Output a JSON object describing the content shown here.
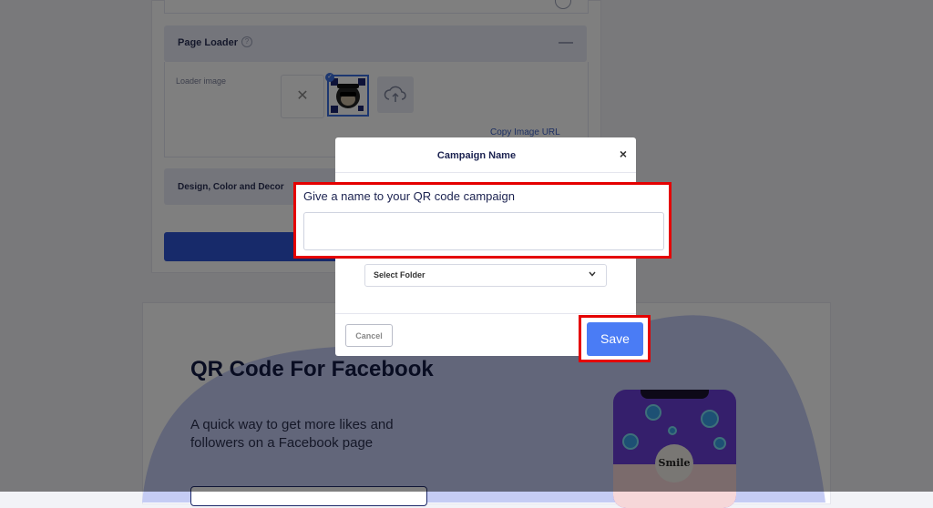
{
  "background": {
    "section_page_loader": {
      "title": "Page Loader",
      "help_icon": "question-circle-icon",
      "collapse_icon": "minus-icon",
      "loader_image_label": "Loader image",
      "copy_image_url": "Copy Image URL"
    },
    "section_design": {
      "title": "Design, Color and Decor"
    },
    "hero": {
      "title": "QR Code For Facebook",
      "description": "A quick way to get more likes and followers on a Facebook page",
      "phone_logo_text": "Smile"
    }
  },
  "modal": {
    "title": "Campaign Name",
    "close_label": "×",
    "name_label": "Give a name to your QR code campaign",
    "name_value": "",
    "folder_select": "Select Folder",
    "cancel_label": "Cancel",
    "save_label": "Save"
  },
  "colors": {
    "primary": "#4a7cf5",
    "highlight_red": "#e50000",
    "overlay": "rgba(0,0,0,0.5)"
  }
}
